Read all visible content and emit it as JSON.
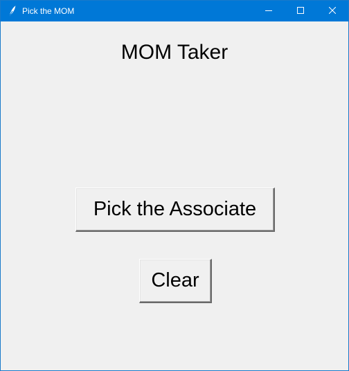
{
  "window": {
    "title": "Pick the MOM",
    "title_bar_color": "#0078d7",
    "background_color": "#f0f0f0",
    "icon": "feather-icon",
    "controls": [
      "minimize-icon",
      "maximize-icon",
      "close-icon"
    ]
  },
  "main": {
    "heading": "MOM Taker",
    "pick_button_label": "Pick the Associate",
    "clear_button_label": "Clear"
  }
}
